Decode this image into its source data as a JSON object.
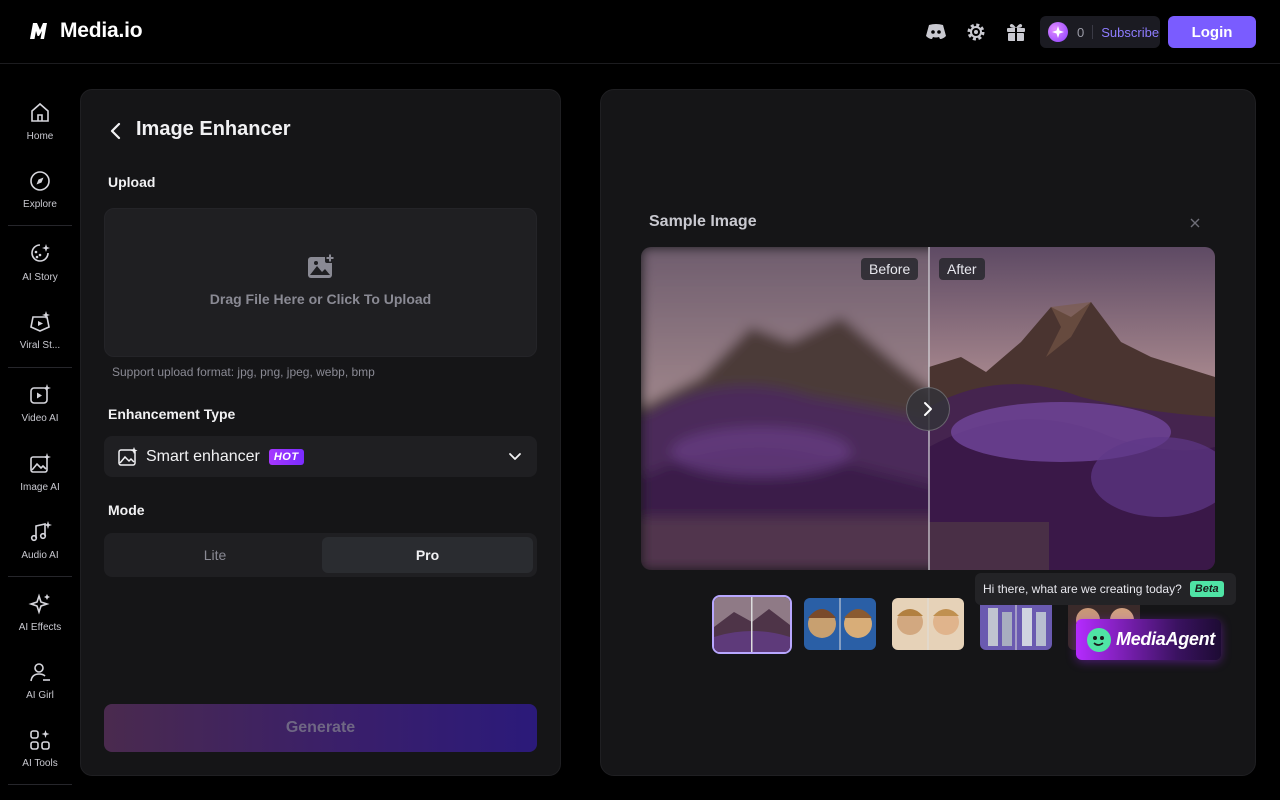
{
  "app": {
    "name": "Media.io"
  },
  "header": {
    "credits_count": "0",
    "subscribe_label": "Subscribe",
    "login_label": "Login",
    "icons": [
      "discord-icon",
      "settings-icon",
      "gift-icon"
    ]
  },
  "sidebar": {
    "items": [
      {
        "label": "Home",
        "icon": "home-icon"
      },
      {
        "label": "Explore",
        "icon": "compass-icon"
      },
      {
        "label": "AI Story",
        "icon": "ai-story-icon"
      },
      {
        "label": "Viral St...",
        "icon": "viral-icon"
      },
      {
        "label": "Video AI",
        "icon": "video-ai-icon"
      },
      {
        "label": "Image AI",
        "icon": "image-ai-icon"
      },
      {
        "label": "Audio AI",
        "icon": "audio-ai-icon"
      },
      {
        "label": "AI Effects",
        "icon": "sparkle-icon"
      },
      {
        "label": "AI Girl",
        "icon": "user-icon"
      },
      {
        "label": "AI Tools",
        "icon": "tools-icon"
      }
    ]
  },
  "tool": {
    "title": "Image Enhancer",
    "upload_label": "Upload",
    "upload_prompt": "Drag File Here or Click To Upload",
    "formats_note": "Support upload format: jpg, png, jpeg, webp, bmp",
    "enhancement_label": "Enhancement Type",
    "enhancement_value": "Smart enhancer",
    "hot_badge": "HOT",
    "mode_label": "Mode",
    "mode_options": [
      "Lite",
      "Pro"
    ],
    "mode_selected": "Pro",
    "generate_label": "Generate"
  },
  "preview": {
    "title": "Sample Image",
    "before_label": "Before",
    "after_label": "After",
    "thumbnails_count": 5,
    "active_thumbnail": 1
  },
  "agent": {
    "greeting": "Hi there, what are we creating today?",
    "beta_badge": "Beta",
    "name": "MediaAgent"
  },
  "colors": {
    "accent": "#7a5cff",
    "panel": "#151517",
    "hot": "#a637ff",
    "beta": "#4fe3a5"
  }
}
